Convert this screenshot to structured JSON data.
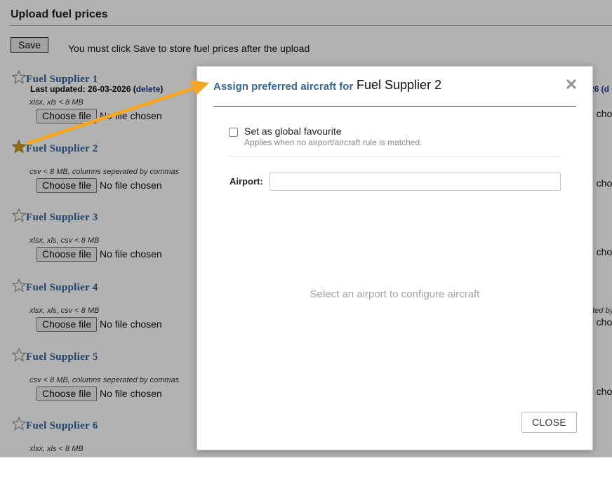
{
  "page": {
    "title": "Upload fuel prices",
    "save_label": "Save",
    "save_note": "You must click Save to store fuel prices after the upload"
  },
  "suppliers": [
    {
      "name": "Fuel Supplier 1",
      "updated_prefix": "Last updated: 26-03-2026 (",
      "delete_label": "delete",
      "updated_suffix": ")",
      "formats": "xlsx, xls < 8 MB",
      "choose_label": "Choose file",
      "file_status": "No file chosen",
      "favourite": false
    },
    {
      "name": "Fuel Supplier 2",
      "formats": "csv < 8 MB, columns seperated by commas",
      "choose_label": "Choose file",
      "file_status": "No file chosen",
      "favourite": true
    },
    {
      "name": "Fuel Supplier 3",
      "formats": "xlsx, xls, csv < 8 MB",
      "choose_label": "Choose file",
      "file_status": "No file chosen",
      "favourite": false
    },
    {
      "name": "Fuel Supplier 4",
      "formats": "xlsx, xls, csv < 8 MB",
      "choose_label": "Choose file",
      "file_status": "No file chosen",
      "favourite": false
    },
    {
      "name": "Fuel Supplier 5",
      "formats": "csv < 8 MB, columns seperated by commas",
      "choose_label": "Choose file",
      "file_status": "No file chosen",
      "favourite": false
    },
    {
      "name": "Fuel Supplier 6",
      "formats": "xlsx, xls < 8 MB",
      "favourite": false
    }
  ],
  "right_column": {
    "updated_fragment": "26 (d",
    "status_fragment": "e chos",
    "formats_fragment": "ated by"
  },
  "modal": {
    "title_prefix": "Assign preferred aircraft for",
    "title_name": "Fuel Supplier 2",
    "close_icon": "close-icon",
    "global_favourite_label": "Set as global favourite",
    "global_favourite_hint": "Applies when no airport/aircraft rule is matched.",
    "global_favourite_checked": false,
    "airport_label": "Airport:",
    "airport_value": "",
    "empty_message": "Select an airport to configure aircraft",
    "close_label": "CLOSE"
  },
  "colors": {
    "callout_arrow": "#f5a623",
    "star_active": "#d4a017",
    "star_inactive": "#9a9a9a",
    "link_blue": "#2e5f9a",
    "modal_title": "#3a6591"
  }
}
